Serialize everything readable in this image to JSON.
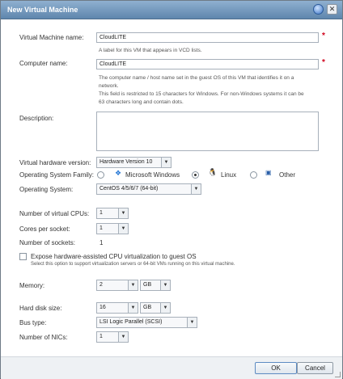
{
  "window": {
    "title": "New Virtual Machine"
  },
  "vm_name": {
    "label": "Virtual Machine name:",
    "value": "CloudLITE",
    "help": "A label for this VM that appears in VCD lists."
  },
  "computer_name": {
    "label": "Computer name:",
    "value": "CloudLITE",
    "help": [
      "The computer name / host name set in the guest OS of this VM that identifies it on a",
      "network.",
      "This field is restricted to 15 characters for Windows. For non-Windows systems it can be",
      "63 characters long and contain dots."
    ]
  },
  "description": {
    "label": "Description:"
  },
  "hardware_version": {
    "label": "Virtual hardware version:",
    "value": "Hardware Version 10"
  },
  "os_family": {
    "label": "Operating System Family:",
    "options": [
      "Microsoft Windows",
      "Linux",
      "Other"
    ],
    "selected": "Linux"
  },
  "os": {
    "label": "Operating System:",
    "value": "CentOS 4/5/6/7 (64-bit)"
  },
  "cpus": {
    "label": "Number of virtual CPUs:",
    "value": "1"
  },
  "cores": {
    "label": "Cores per socket:",
    "value": "1"
  },
  "sockets": {
    "label": "Number of sockets:",
    "value": "1"
  },
  "expose": {
    "label": "Expose hardware-assisted CPU virtualization to guest OS",
    "help": "Select this option to support virtualization servers or 64-bit VMs running on this virtual machine."
  },
  "memory": {
    "label": "Memory:",
    "value": "2",
    "unit": "GB"
  },
  "disk": {
    "label": "Hard disk size:",
    "value": "16",
    "unit": "GB"
  },
  "bus": {
    "label": "Bus type:",
    "value": "LSI Logic Parallel (SCSI)"
  },
  "nics": {
    "label": "Number of NICs:",
    "value": "1"
  },
  "footer": {
    "ok": "OK",
    "cancel": "Cancel"
  },
  "colors": {
    "title_bar": "#6f93b8",
    "required": "#d0021b"
  }
}
